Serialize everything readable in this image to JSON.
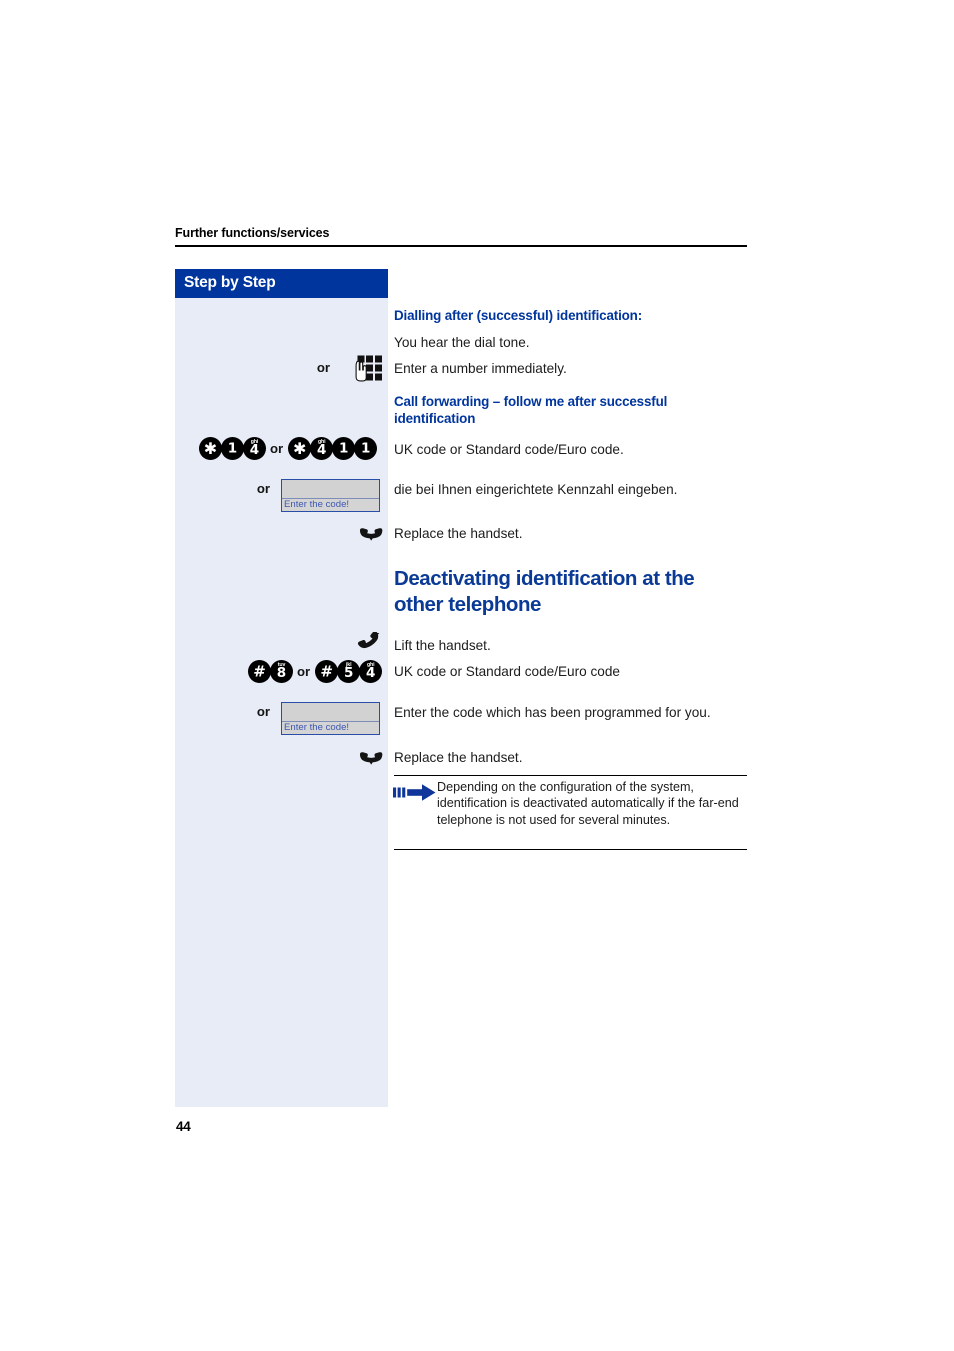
{
  "document": {
    "running_head": "Further functions/services",
    "page_number": "44"
  },
  "sidebar": {
    "title": "Step by Step"
  },
  "content": {
    "heading_dialling": "Dialling after (successful) identification:",
    "line_dial_tone": "You hear the dial tone.",
    "line_enter_number": "Enter a number immediately.",
    "heading_call_forwarding": "Call forwarding – follow me after successful identification",
    "line_uk_code_1": "UK code or Standard code/Euro code.",
    "line_kennzahl": "die bei Ihnen eingerichtete Kennzahl eingeben.",
    "line_replace_handset_1": "Replace the handset.",
    "section_title": "Deactivating identification at the other telephone",
    "line_lift_handset": "Lift the handset.",
    "line_uk_code_2": "UK code or Standard code/Euro code",
    "line_enter_programmed_code": "Enter the code which has been programmed for you.",
    "line_replace_handset_2": "Replace the handset.",
    "note": "Depending on the configuration of the system, identification is deactivated automatically if the far-end telephone is not used for several minutes."
  },
  "labels": {
    "or": "or",
    "code_field_caption": "Enter the code!"
  },
  "key_sequences": {
    "forwarding_uk": [
      {
        "glyph": "*",
        "letters": ""
      },
      {
        "glyph": "1",
        "letters": ""
      },
      {
        "glyph": "4",
        "letters": "ghi"
      }
    ],
    "forwarding_euro": [
      {
        "glyph": "*",
        "letters": ""
      },
      {
        "glyph": "4",
        "letters": "ghi"
      },
      {
        "glyph": "1",
        "letters": ""
      },
      {
        "glyph": "1",
        "letters": ""
      }
    ],
    "deactivate_uk": [
      {
        "glyph": "#",
        "letters": ""
      },
      {
        "glyph": "8",
        "letters": "tuv"
      }
    ],
    "deactivate_euro": [
      {
        "glyph": "#",
        "letters": ""
      },
      {
        "glyph": "5",
        "letters": "jkl"
      },
      {
        "glyph": "4",
        "letters": "ghi"
      }
    ]
  },
  "icons": {
    "keypad": "keypad-with-hand-icon",
    "replace_handset": "handset-down-icon",
    "lift_handset": "handset-lift-icon",
    "note": "blue-arrow-note-icon"
  },
  "colors": {
    "brand_blue": "#00359e",
    "heading_blue": "#0a3a96",
    "sidebar_bg": "#e8ecf7",
    "key_black": "#000000",
    "field_border": "#2a4ea8",
    "field_caption": "#3d57b3"
  }
}
